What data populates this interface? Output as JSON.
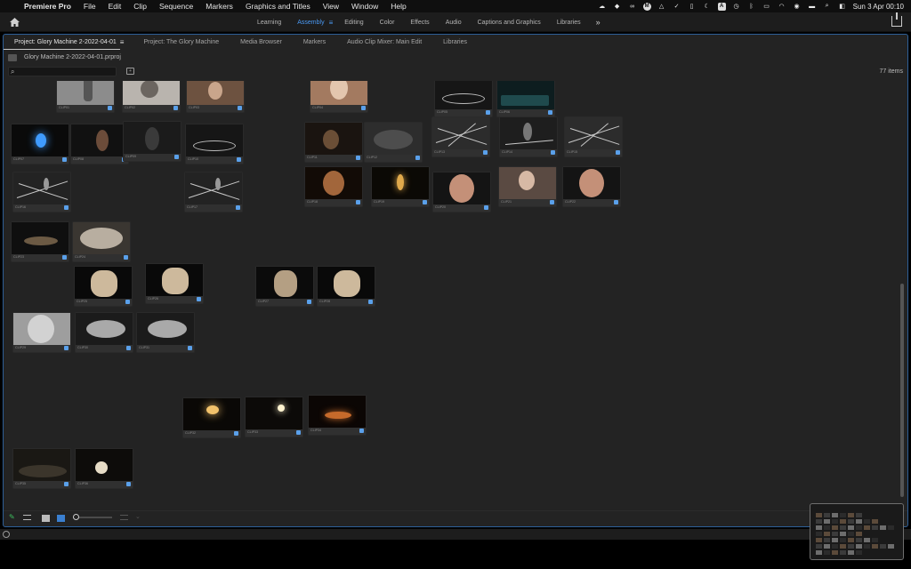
{
  "menubar": {
    "apple_glyph": "",
    "app_name": "Premiere Pro",
    "items": [
      "File",
      "Edit",
      "Clip",
      "Sequence",
      "Markers",
      "Graphics and Titles",
      "View",
      "Window",
      "Help"
    ],
    "status_icons": [
      "cloud-icon",
      "dropbox-icon",
      "creative-cloud-icon",
      "m-badge-icon",
      "drive-icon",
      "v-check-icon",
      "phone-icon",
      "moon-icon",
      "text-a-icon",
      "clock-icon",
      "bluetooth-icon",
      "battery-icon",
      "wifi-icon",
      "user-icon",
      "display-icon",
      "search-icon",
      "control-center-icon"
    ],
    "badge_m": "M",
    "badge_a": "A",
    "date_time": "Sun 3 Apr  00:10"
  },
  "workspace": {
    "tabs": [
      {
        "label": "Learning",
        "active": false
      },
      {
        "label": "Assembly",
        "active": true
      },
      {
        "label": "Editing",
        "active": false
      },
      {
        "label": "Color",
        "active": false
      },
      {
        "label": "Effects",
        "active": false
      },
      {
        "label": "Audio",
        "active": false
      },
      {
        "label": "Captions and Graphics",
        "active": false
      },
      {
        "label": "Libraries",
        "active": false
      }
    ],
    "menu_glyph": "≡",
    "more_glyph": "»",
    "accent_color": "#4a9af5"
  },
  "panel": {
    "tabs": [
      {
        "label": "Project: Glory Machine 2-2022-04-01",
        "active": true
      },
      {
        "label": "Project: The Glory Machine",
        "active": false
      },
      {
        "label": "Media Browser",
        "active": false
      },
      {
        "label": "Markers",
        "active": false
      },
      {
        "label": "Audio Clip Mixer: Main Edit",
        "active": false
      },
      {
        "label": "Libraries",
        "active": false
      }
    ],
    "tab_menu_glyph": "≡",
    "project_file": "Glory Machine 2-2022-04-01.prproj",
    "search_placeholder": "",
    "item_count": "77 items",
    "border_color": "#2d5f98"
  },
  "clips": [
    {
      "scene": "dancer-gray",
      "label": "CLIP01"
    },
    {
      "scene": "hands-gray",
      "label": "CLIP02"
    },
    {
      "scene": "woman-warm",
      "label": "CLIP03"
    },
    {
      "scene": "woman-warm-bright",
      "label": "CLIP04"
    },
    {
      "scene": "floor-circle",
      "label": "CLIP05"
    },
    {
      "scene": "teal-bench",
      "label": "CLIP06"
    },
    {
      "scene": "blue-flame",
      "label": "CLIP07"
    },
    {
      "scene": "figure-table",
      "label": "CLIP08"
    },
    {
      "scene": "dark-figure",
      "label": "CLIP09"
    },
    {
      "scene": "floor-circle",
      "label": "CLIP10"
    },
    {
      "scene": "dark-warm-figure",
      "label": "CLIP11"
    },
    {
      "scene": "crowd-gray",
      "label": "CLIP12"
    },
    {
      "scene": "stage-lines",
      "label": "CLIP13"
    },
    {
      "scene": "stage-figure",
      "label": "CLIP14"
    },
    {
      "scene": "stage-lines",
      "label": "CLIP15"
    },
    {
      "scene": "stage-lines-figure",
      "label": "CLIP16"
    },
    {
      "scene": "stage-lines-figure",
      "label": "CLIP17"
    },
    {
      "scene": "screaming-face",
      "label": "CLIP18"
    },
    {
      "scene": "candle",
      "label": "CLIP19"
    },
    {
      "scene": "face-closeup",
      "label": "CLIP20"
    },
    {
      "scene": "woman-table",
      "label": "CLIP21"
    },
    {
      "scene": "face-closeup",
      "label": "CLIP22"
    },
    {
      "scene": "table-objects",
      "label": "CLIP23"
    },
    {
      "scene": "rug",
      "label": "CLIP24"
    },
    {
      "scene": "lion",
      "label": "CLIP25"
    },
    {
      "scene": "lion",
      "label": "CLIP26"
    },
    {
      "scene": "lion-side",
      "label": "CLIP27"
    },
    {
      "scene": "lion",
      "label": "CLIP28"
    },
    {
      "scene": "screaming-gray",
      "label": "CLIP29"
    },
    {
      "scene": "statues",
      "label": "CLIP30"
    },
    {
      "scene": "statues",
      "label": "CLIP31"
    },
    {
      "scene": "lamp",
      "label": "CLIP32"
    },
    {
      "scene": "hand-light",
      "label": "CLIP33"
    },
    {
      "scene": "candles",
      "label": "CLIP34"
    },
    {
      "scene": "dark-table",
      "label": "CLIP35"
    },
    {
      "scene": "candle-table",
      "label": "CLIP36"
    }
  ],
  "bottom_toolbar": {
    "tools": [
      "pencil-icon",
      "list-view-icon",
      "icon-view-icon",
      "freeform-view-icon",
      "zoom-slider",
      "sort-icon"
    ],
    "sort_chevron": "⌄",
    "zoom_level": 0.05
  }
}
